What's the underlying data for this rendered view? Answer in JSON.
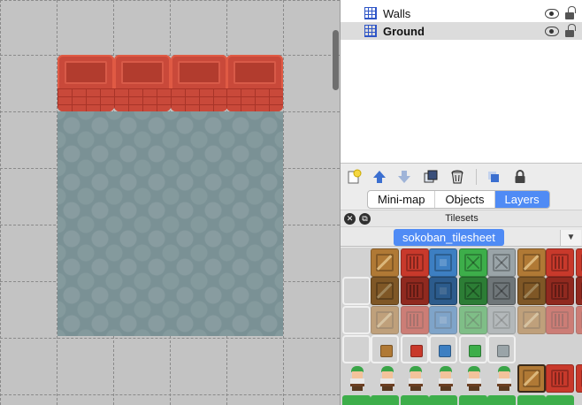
{
  "layers_panel": {
    "layers": [
      {
        "name": "Walls",
        "icon": "tile-layer-icon",
        "visible": true,
        "locked": false,
        "selected": false
      },
      {
        "name": "Ground",
        "icon": "tile-layer-icon",
        "visible": true,
        "locked": false,
        "selected": true
      }
    ],
    "toolbar": [
      "new-layer-icon",
      "raise-layer-icon",
      "lower-layer-icon",
      "duplicate-layer-icon",
      "remove-layer-icon",
      "toggle-other-layers-icon",
      "lock-layer-icon"
    ]
  },
  "dock_tabs": [
    {
      "label": "Mini-map",
      "active": false
    },
    {
      "label": "Objects",
      "active": false
    },
    {
      "label": "Layers",
      "active": true
    }
  ],
  "tilesets": {
    "title": "Tilesets",
    "active_tileset": "sokoban_tilesheet",
    "dropdown_glyph": "▼"
  },
  "colors": {
    "accent": "#4f8bf5",
    "wall_red": "#c9493a",
    "ground_slate": "#7a9195",
    "crate_brown": "#b07935",
    "crate_red": "#c8392b",
    "crate_blue": "#3d7fc2",
    "crate_green": "#3dae4a",
    "crate_grey": "#9aa4a8"
  }
}
